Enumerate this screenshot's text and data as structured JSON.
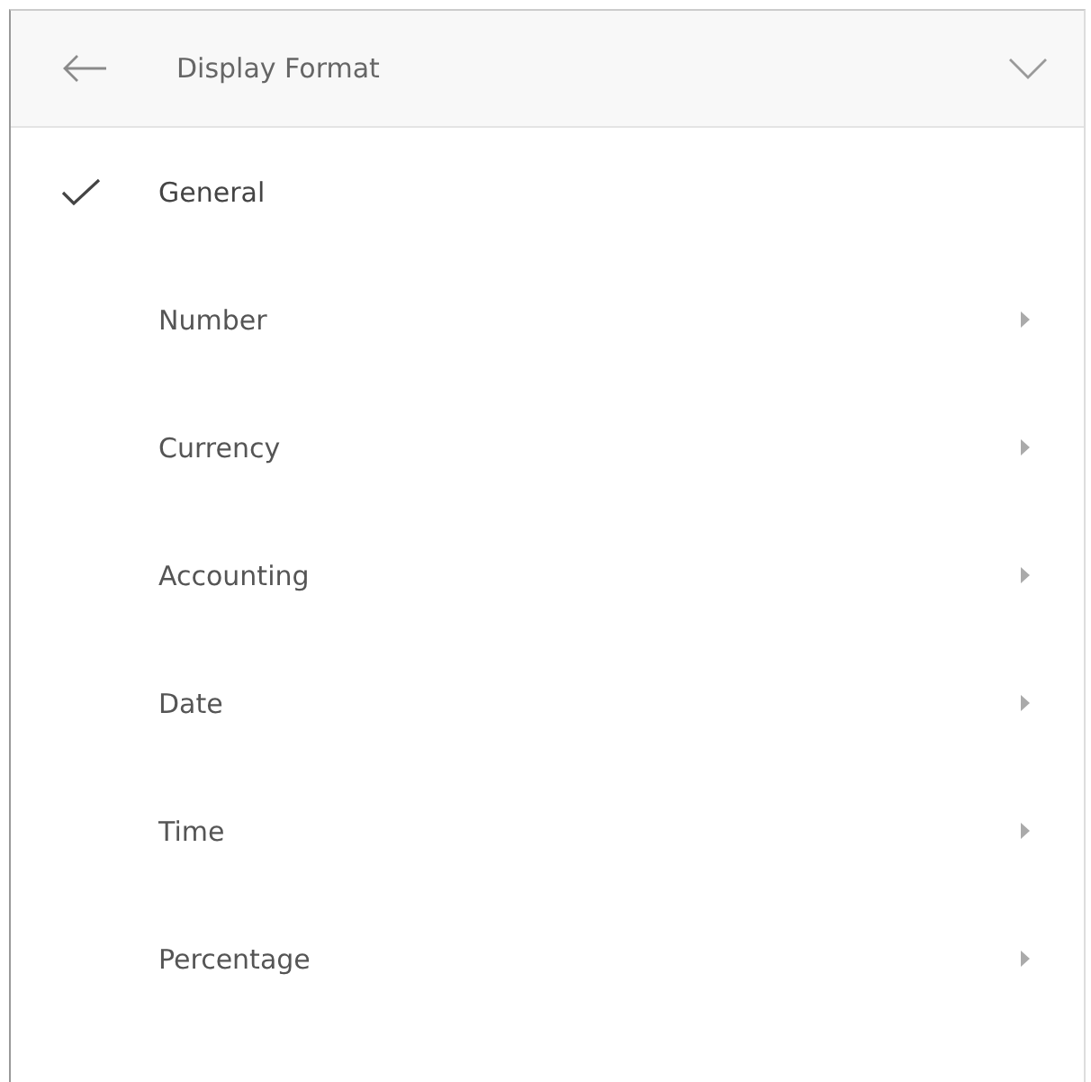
{
  "header": {
    "title": "Display Format"
  },
  "items": [
    {
      "label": "General",
      "selected": true,
      "kind": "option"
    },
    {
      "label": "Number",
      "selected": false,
      "kind": "submenu"
    },
    {
      "label": "Currency",
      "selected": false,
      "kind": "submenu"
    },
    {
      "label": "Accounting",
      "selected": false,
      "kind": "submenu"
    },
    {
      "label": "Date",
      "selected": false,
      "kind": "submenu"
    },
    {
      "label": "Time",
      "selected": false,
      "kind": "submenu"
    },
    {
      "label": "Percentage",
      "selected": false,
      "kind": "submenu"
    }
  ]
}
